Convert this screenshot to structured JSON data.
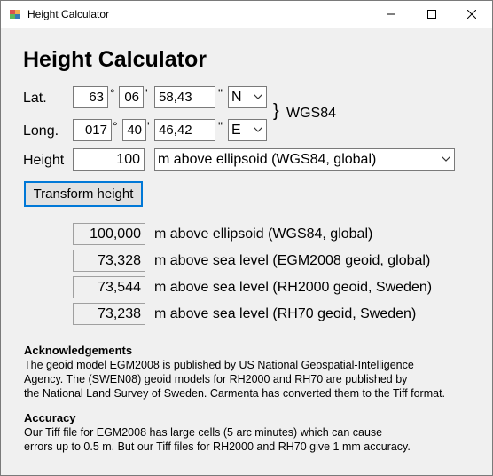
{
  "window": {
    "title": "Height Calculator"
  },
  "heading": "Height Calculator",
  "lat": {
    "label": "Lat.",
    "deg": "63",
    "deg_sym": "°",
    "min": "06",
    "min_sym": "'",
    "sec": "58,43",
    "sec_sym": "\"",
    "hemisphere": "N"
  },
  "long": {
    "label": "Long.",
    "deg": "017",
    "deg_sym": "°",
    "min": "40",
    "min_sym": "'",
    "sec": "46,42",
    "sec_sym": "\"",
    "hemisphere": "E"
  },
  "datum": {
    "brace": "}",
    "label": "WGS84"
  },
  "height": {
    "label": "Height",
    "value": "100",
    "reference": "m above ellipsoid (WGS84, global)"
  },
  "transform_button": "Transform height",
  "results": [
    {
      "value": "100,000",
      "label": "m above ellipsoid (WGS84, global)"
    },
    {
      "value": "73,328",
      "label": "m above sea level (EGM2008 geoid, global)"
    },
    {
      "value": "73,544",
      "label": "m above sea level (RH2000 geoid, Sweden)"
    },
    {
      "value": "73,238",
      "label": "m above sea level (RH70 geoid, Sweden)"
    }
  ],
  "acknowledgements": {
    "heading": "Acknowledgements",
    "lines": [
      "The geoid model EGM2008 is published by US National Geospatial-Intelligence",
      "Agency.  The (SWEN08) geoid models for RH2000 and RH70 are published by",
      "the National Land Survey of Sweden.  Carmenta has converted them to the Tiff format."
    ]
  },
  "accuracy": {
    "heading": "Accuracy",
    "lines": [
      "Our Tiff file for EGM2008 has large cells (5 arc minutes) which can cause",
      "errors up to 0.5 m.  But our Tiff files for RH2000 and RH70 give 1 mm accuracy."
    ]
  },
  "colors": {
    "focus_border": "#0078d7",
    "window_bg": "#f0f0f0"
  },
  "icons": [
    "app-icon",
    "minimize-icon",
    "maximize-icon",
    "close-icon",
    "chevron-down-icon"
  ]
}
